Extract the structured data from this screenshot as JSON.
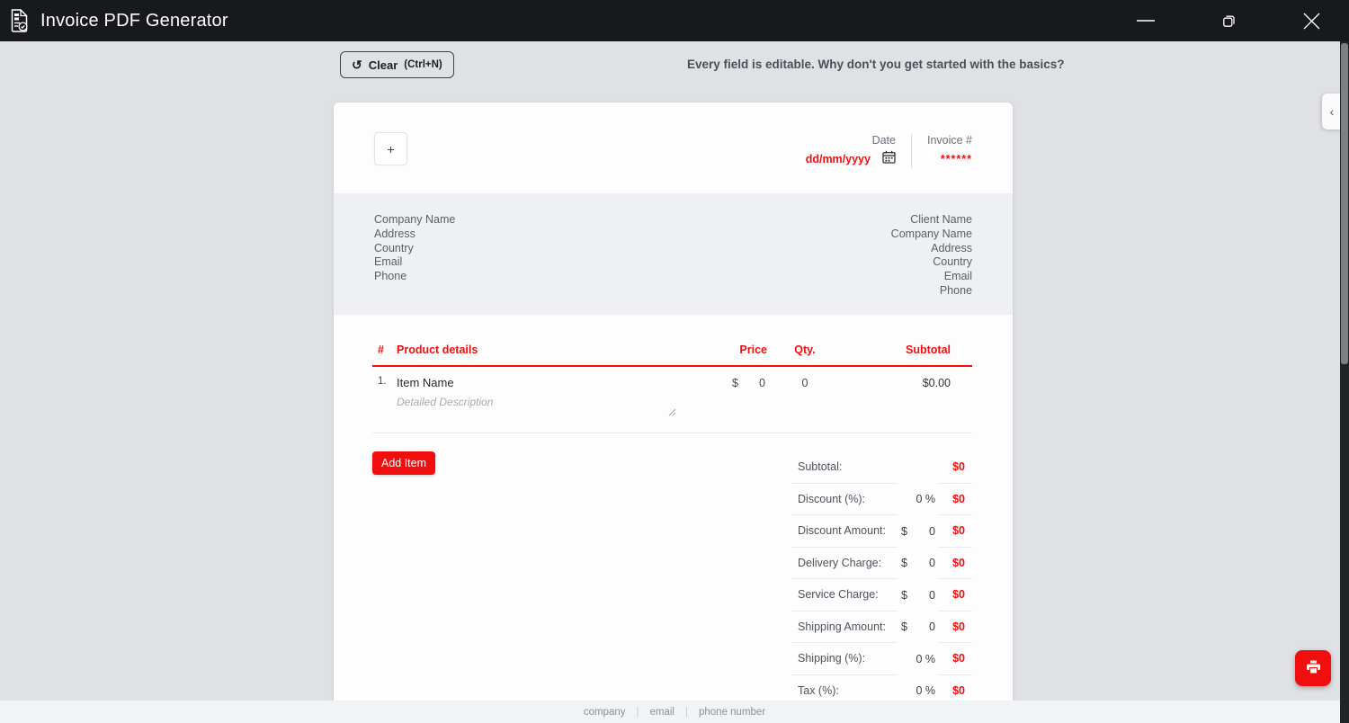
{
  "app": {
    "title": "Invoice PDF Generator"
  },
  "icons": {
    "refresh": "↺",
    "chevron_left": "‹",
    "plus": "+"
  },
  "toolbar": {
    "clear_label": "Clear",
    "clear_shortcut": "(Ctrl+N)",
    "hint": "Every field is editable. Why don't you get started with the basics?"
  },
  "invoice": {
    "date": {
      "label": "Date",
      "value": "dd/mm/yyyy"
    },
    "invoice_number": {
      "label": "Invoice #",
      "value": "******"
    },
    "company_fields": [
      "Company Name",
      "Address",
      "Country",
      "Email",
      "Phone"
    ],
    "client_fields": [
      "Client Name",
      "Company Name",
      "Address",
      "Country",
      "Email",
      "Phone"
    ],
    "table": {
      "col_index": "#",
      "col_details": "Product details",
      "col_price": "Price",
      "col_qty": "Qty.",
      "col_subtotal": "Subtotal",
      "row": {
        "index": "1.",
        "name": "Item Name",
        "currency": "$",
        "price": "0",
        "qty": "0",
        "subtotal": "$0.00",
        "description": "Detailed Description"
      }
    },
    "add_item_label": "Add Item",
    "totals": [
      {
        "label": "Subtotal:",
        "prefix": "",
        "value": "",
        "amount": "$0"
      },
      {
        "label": "Discount (%):",
        "prefix": "",
        "value": "0 %",
        "amount": "$0"
      },
      {
        "label": "Discount Amount:",
        "prefix": "$",
        "value": "0",
        "amount": "$0"
      },
      {
        "label": "Delivery Charge:",
        "prefix": "$",
        "value": "0",
        "amount": "$0"
      },
      {
        "label": "Service Charge:",
        "prefix": "$",
        "value": "0",
        "amount": "$0"
      },
      {
        "label": "Shipping Amount:",
        "prefix": "$",
        "value": "0",
        "amount": "$0"
      },
      {
        "label": "Shipping (%):",
        "prefix": "",
        "value": "0 %",
        "amount": "$0"
      },
      {
        "label": "Tax (%):",
        "prefix": "",
        "value": "0 %",
        "amount": "$0"
      }
    ],
    "footer_fields": [
      "company",
      "email",
      "phone number"
    ]
  },
  "colors": {
    "accent_red": "#f10e0e",
    "titlebar_bg": "#17191d",
    "body_bg": "#e0e1e4",
    "info_section_bg": "#eef0f3",
    "footer_strip_bg": "#f1f3f6"
  }
}
